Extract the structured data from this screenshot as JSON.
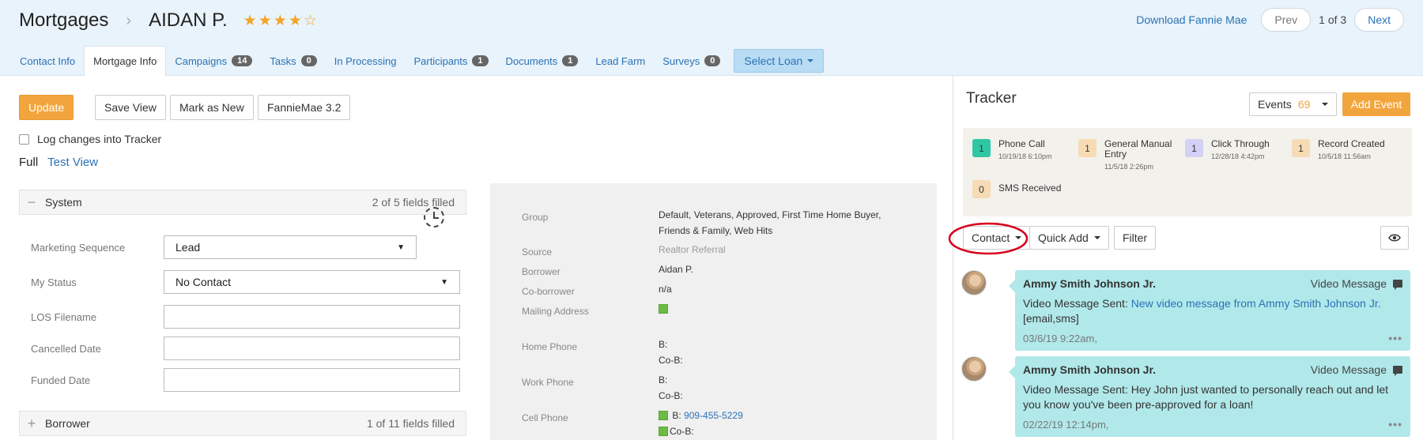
{
  "header": {
    "module": "Mortgages",
    "contact_name": "AIDAN P.",
    "rating": 4,
    "rating_max": 5,
    "download_link": "Download Fannie Mae",
    "prev_label": "Prev",
    "page_count": "1 of 3",
    "next_label": "Next"
  },
  "tabs": [
    {
      "label": "Contact Info"
    },
    {
      "label": "Mortgage Info",
      "active": true
    },
    {
      "label": "Campaigns",
      "badge": "14"
    },
    {
      "label": "Tasks",
      "badge": "0"
    },
    {
      "label": "In Processing"
    },
    {
      "label": "Participants",
      "badge": "1"
    },
    {
      "label": "Documents",
      "badge": "1"
    },
    {
      "label": "Lead Farm"
    },
    {
      "label": "Surveys",
      "badge": "0"
    }
  ],
  "select_loan": "Select Loan",
  "toolbar": {
    "update": "Update",
    "save_view": "Save View",
    "mark_new": "Mark as New",
    "fannie": "FannieMae 3.2",
    "log_changes": "Log changes into Tracker",
    "view_full": "Full",
    "view_test": "Test View"
  },
  "system_section": {
    "title": "System",
    "count": "2 of 5 fields filled",
    "fields": [
      {
        "label": "Marketing Sequence",
        "value": "Lead"
      },
      {
        "label": "My Status",
        "value": "No Contact"
      },
      {
        "label": "LOS Filename",
        "value": ""
      },
      {
        "label": "Cancelled Date",
        "value": ""
      },
      {
        "label": "Funded Date",
        "value": ""
      }
    ]
  },
  "borrower_section": {
    "title": "Borrower",
    "count": "1 of 11 fields filled"
  },
  "info": {
    "group_label": "Group",
    "group_line1": "Default, Veterans, Approved, First Time Home Buyer,",
    "group_line2": "Friends & Family, Web Hits",
    "source_label": "Source",
    "source_value": "Realtor Referral",
    "borrower_label": "Borrower",
    "borrower_value": "Aidan P.",
    "coborrower_label": "Co-borrower",
    "coborrower_value": "n/a",
    "mailing_label": "Mailing Address",
    "home_label": "Home Phone",
    "home_b": "B:",
    "home_cob": "Co-B:",
    "work_label": "Work Phone",
    "work_b": "B:",
    "work_cob": "Co-B:",
    "cell_label": "Cell Phone",
    "cell_b": "B:",
    "cell_b_number": "909-455-5229",
    "cell_cob": "Co-B:"
  },
  "tracker": {
    "title": "Tracker",
    "events_label": "Events",
    "events_count": "69",
    "add_event": "Add Event",
    "summary": [
      {
        "count": "1",
        "title": "Phone Call",
        "date": "10/19/18 6:10pm",
        "color": "#2fc7a3"
      },
      {
        "count": "1",
        "title": "General Manual Entry",
        "date": "11/5/18 2:26pm",
        "color": "#f7dbb5"
      },
      {
        "count": "1",
        "title": "Click Through",
        "date": "12/28/18 4:42pm",
        "color": "#d3d1f5"
      },
      {
        "count": "1",
        "title": "Record Created",
        "date": "10/5/18 11:56am",
        "color": "#f7dbb5"
      },
      {
        "count": "0",
        "title": "SMS Received",
        "date": "",
        "color": "#f7dbb5"
      }
    ],
    "contact_btn": "Contact",
    "quick_add_btn": "Quick Add",
    "filter_btn": "Filter",
    "messages": [
      {
        "author": "Ammy Smith Johnson Jr.",
        "type": "Video Message",
        "body_prefix": "Video Message Sent: ",
        "body_link": "New video message from Ammy Smith Johnson Jr.",
        "body_suffix": "[email,sms]",
        "time": "03/6/19 9:22am,"
      },
      {
        "author": "Ammy Smith Johnson Jr.",
        "type": "Video Message",
        "body_prefix": "Video Message Sent: Hey John just wanted to personally reach out and let you know you've been pre-approved for a loan!",
        "body_link": "",
        "body_suffix": "",
        "time": "02/22/19 12:14pm,"
      }
    ]
  }
}
